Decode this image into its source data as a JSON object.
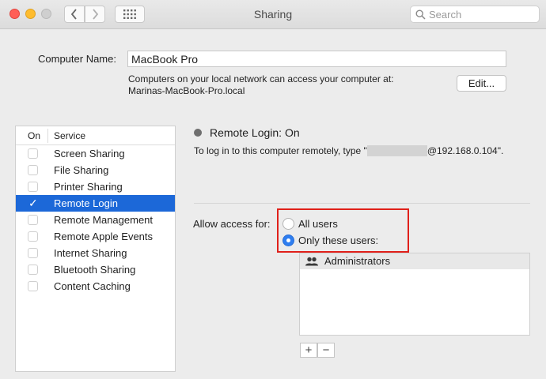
{
  "window": {
    "title": "Sharing"
  },
  "toolbar": {
    "back_icon": "chevron-left-icon",
    "forward_icon": "chevron-right-icon",
    "grid_icon": "grid-icon"
  },
  "search": {
    "placeholder": "Search",
    "value": ""
  },
  "computer": {
    "label": "Computer Name:",
    "value": "MacBook Pro",
    "info_line1": "Computers on your local network can access your computer at:",
    "info_line2": "Marinas-MacBook-Pro.local",
    "edit_label": "Edit..."
  },
  "services": {
    "col_on": "On",
    "col_service": "Service",
    "items": [
      {
        "label": "Screen Sharing",
        "checked": false
      },
      {
        "label": "File Sharing",
        "checked": false
      },
      {
        "label": "Printer Sharing",
        "checked": false
      },
      {
        "label": "Remote Login",
        "checked": true,
        "selected": true
      },
      {
        "label": "Remote Management",
        "checked": false
      },
      {
        "label": "Remote Apple Events",
        "checked": false
      },
      {
        "label": "Internet Sharing",
        "checked": false
      },
      {
        "label": "Bluetooth Sharing",
        "checked": false
      },
      {
        "label": "Content Caching",
        "checked": false
      }
    ]
  },
  "detail": {
    "status": "Remote Login: On",
    "login_prefix": "To log in to this computer remotely, type \"",
    "login_suffix": "@192.168.0.104\".",
    "access_label": "Allow access for:",
    "option_all": "All users",
    "option_only": "Only these users:",
    "selected_option": "only",
    "users": [
      {
        "name": "Administrators",
        "icon": "group-icon"
      }
    ],
    "add_label": "+",
    "remove_label": "−"
  },
  "colors": {
    "selection": "#1c68d8",
    "highlight_box": "#e0201a",
    "radio_on": "#2f7ef0"
  }
}
